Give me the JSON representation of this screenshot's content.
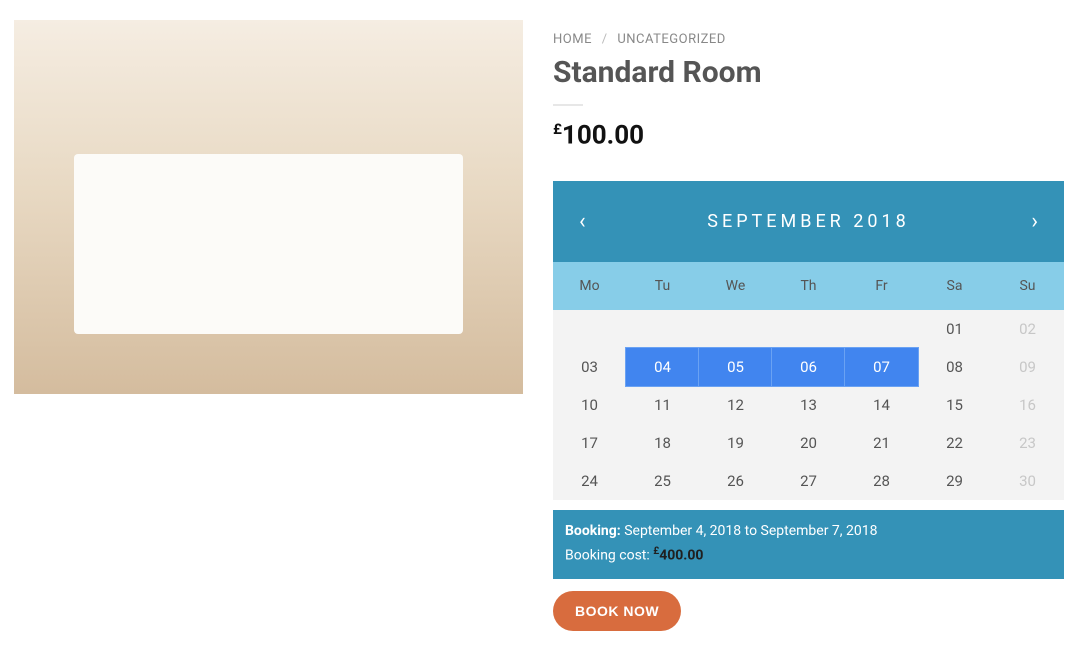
{
  "breadcrumb": {
    "home": "HOME",
    "sep": "/",
    "category": "UNCATEGORIZED"
  },
  "title": "Standard Room",
  "price": {
    "currency": "£",
    "amount": "100.00"
  },
  "calendar": {
    "prev": "‹",
    "next": "›",
    "month_label": "SEPTEMBER 2018",
    "dow": [
      "Mo",
      "Tu",
      "We",
      "Th",
      "Fr",
      "Sa",
      "Su"
    ],
    "weeks": [
      [
        null,
        null,
        null,
        null,
        null,
        {
          "d": "01"
        },
        {
          "d": "02",
          "disabled": true
        }
      ],
      [
        {
          "d": "03"
        },
        {
          "d": "04",
          "selected": true
        },
        {
          "d": "05",
          "selected": true
        },
        {
          "d": "06",
          "selected": true
        },
        {
          "d": "07",
          "selected": true
        },
        {
          "d": "08"
        },
        {
          "d": "09",
          "disabled": true
        }
      ],
      [
        {
          "d": "10"
        },
        {
          "d": "11"
        },
        {
          "d": "12"
        },
        {
          "d": "13"
        },
        {
          "d": "14"
        },
        {
          "d": "15"
        },
        {
          "d": "16",
          "disabled": true
        }
      ],
      [
        {
          "d": "17"
        },
        {
          "d": "18"
        },
        {
          "d": "19"
        },
        {
          "d": "20"
        },
        {
          "d": "21"
        },
        {
          "d": "22"
        },
        {
          "d": "23",
          "disabled": true
        }
      ],
      [
        {
          "d": "24"
        },
        {
          "d": "25"
        },
        {
          "d": "26"
        },
        {
          "d": "27"
        },
        {
          "d": "28"
        },
        {
          "d": "29"
        },
        {
          "d": "30",
          "disabled": true
        }
      ]
    ]
  },
  "booking": {
    "label": "Booking:",
    "range": "September 4, 2018 to September 7, 2018",
    "cost_label": "Booking cost:",
    "cost_currency": "£",
    "cost_amount": "400.00"
  },
  "actions": {
    "book": "BOOK NOW"
  }
}
